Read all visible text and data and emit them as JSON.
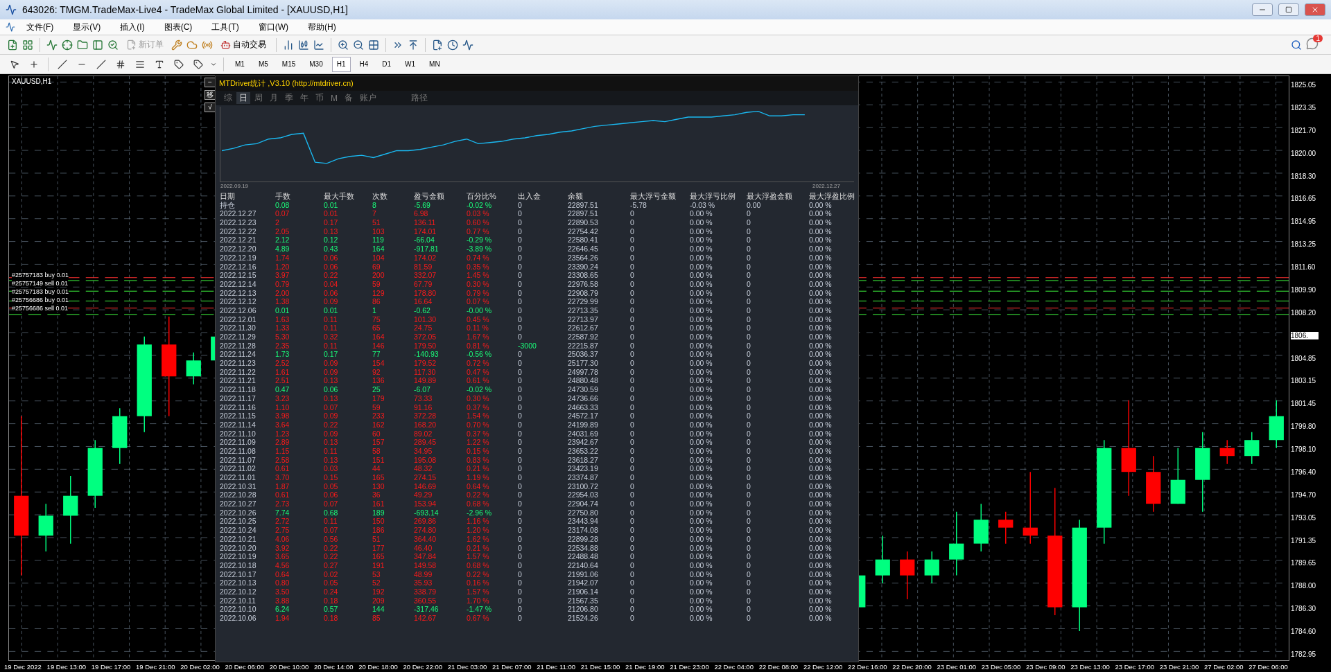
{
  "window": {
    "title": "643026: TMGM.TradeMax-Live4 - TradeMax Global Limited - [XAUUSD,H1]"
  },
  "menu": [
    "文件(F)",
    "显示(V)",
    "插入(I)",
    "图表(C)",
    "工具(T)",
    "窗口(W)",
    "帮助(H)"
  ],
  "toolbar": {
    "new_order": {
      "label": "新订单",
      "disabled": true
    },
    "auto_trading": {
      "label": "自动交易"
    },
    "notification_count": "1"
  },
  "timeframes": [
    {
      "label": "M1",
      "selected": false
    },
    {
      "label": "M5",
      "selected": false
    },
    {
      "label": "M15",
      "selected": false
    },
    {
      "label": "M30",
      "selected": false
    },
    {
      "label": "H1",
      "selected": true
    },
    {
      "label": "H4",
      "selected": false
    },
    {
      "label": "D1",
      "selected": false
    },
    {
      "label": "W1",
      "selected": false
    },
    {
      "label": "MN",
      "selected": false
    }
  ],
  "chart": {
    "symbol": "XAUUSD,H1",
    "side_buttons": [
      "−",
      "移",
      "√"
    ],
    "orders": [
      "#25757183 buy 0.01",
      "#25757149 sell 0.01",
      "#25757183 buy 0.01",
      "#25756686 buy 0.01",
      "#25756686 sell 0.01"
    ],
    "price_axis": [
      "1825.05",
      "1823.35",
      "1821.70",
      "1820.00",
      "1818.30",
      "1816.65",
      "1814.95",
      "1813.25",
      "1811.60",
      "1809.90",
      "1808.20",
      "1806.",
      "1804.85",
      "1803.15",
      "1801.45",
      "1799.80",
      "1798.10",
      "1796.40",
      "1794.70",
      "1793.05",
      "1791.35",
      "1789.65",
      "1788.00",
      "1786.30",
      "1784.60",
      "1782.95"
    ],
    "time_axis": [
      "19 Dec 2022",
      "19 Dec 13:00",
      "19 Dec 17:00",
      "19 Dec 21:00",
      "20 Dec 02:00",
      "20 Dec 06:00",
      "20 Dec 10:00",
      "20 Dec 14:00",
      "20 Dec 18:00",
      "20 Dec 22:00",
      "21 Dec 03:00",
      "21 Dec 07:00",
      "21 Dec 11:00",
      "21 Dec 15:00",
      "21 Dec 19:00",
      "21 Dec 23:00",
      "22 Dec 04:00",
      "22 Dec 08:00",
      "22 Dec 12:00",
      "22 Dec 16:00",
      "22 Dec 20:00",
      "23 Dec 01:00",
      "23 Dec 05:00",
      "23 Dec 09:00",
      "23 Dec 13:00",
      "23 Dec 17:00",
      "23 Dec 21:00",
      "27 Dec 02:00",
      "27 Dec 06:00"
    ]
  },
  "stats": {
    "title": "MTDriver统计 ,V3.10 (http://mtdriver.cn)",
    "tabs": [
      {
        "label": "综",
        "selected": false
      },
      {
        "label": "日",
        "selected": true
      },
      {
        "label": "周",
        "selected": false
      },
      {
        "label": "月",
        "selected": false
      },
      {
        "label": "季",
        "selected": false
      },
      {
        "label": "年",
        "selected": false
      },
      {
        "label": "币",
        "selected": false
      },
      {
        "label": "M",
        "selected": false
      },
      {
        "label": "备",
        "selected": false
      },
      {
        "label": "账户",
        "selected": false
      },
      {
        "label": "路径",
        "selected": false
      }
    ],
    "curve_start": "2022.09.19",
    "curve_end": "2022.12.27",
    "columns": [
      "日期",
      "手数",
      "最大手数",
      "次数",
      "盈亏金额",
      "百分比%",
      "出入金",
      "余额",
      "最大浮亏金额",
      "最大浮亏比例",
      "最大浮盈金额",
      "最大浮盈比例"
    ],
    "rows": [
      {
        "kind": "loss",
        "cells": [
          "持仓",
          "0.08",
          "0.01",
          "8",
          "-5.69",
          "-0.02 %",
          "0",
          "22897.51",
          "-5.78",
          "-0.03 %",
          "0.00",
          "0.00 %"
        ]
      },
      {
        "kind": "profit",
        "cells": [
          "2022.12.27",
          "0.07",
          "0.01",
          "7",
          "6.98",
          "0.03 %",
          "0",
          "22897.51",
          "0",
          "0.00 %",
          "0",
          "0.00 %"
        ]
      },
      {
        "kind": "profit",
        "cells": [
          "2022.12.23",
          "2",
          "0.17",
          "51",
          "136.11",
          "0.60 %",
          "0",
          "22890.53",
          "0",
          "0.00 %",
          "0",
          "0.00 %"
        ]
      },
      {
        "kind": "profit",
        "cells": [
          "2022.12.22",
          "2.05",
          "0.13",
          "103",
          "174.01",
          "0.77 %",
          "0",
          "22754.42",
          "0",
          "0.00 %",
          "0",
          "0.00 %"
        ]
      },
      {
        "kind": "loss",
        "cells": [
          "2022.12.21",
          "2.12",
          "0.12",
          "119",
          "-66.04",
          "-0.29 %",
          "0",
          "22580.41",
          "0",
          "0.00 %",
          "0",
          "0.00 %"
        ]
      },
      {
        "kind": "loss",
        "cells": [
          "2022.12.20",
          "4.89",
          "0.43",
          "164",
          "-917.81",
          "-3.89 %",
          "0",
          "22646.45",
          "0",
          "0.00 %",
          "0",
          "0.00 %"
        ]
      },
      {
        "kind": "profit",
        "cells": [
          "2022.12.19",
          "1.74",
          "0.06",
          "104",
          "174.02",
          "0.74 %",
          "0",
          "23564.26",
          "0",
          "0.00 %",
          "0",
          "0.00 %"
        ]
      },
      {
        "kind": "profit",
        "cells": [
          "2022.12.16",
          "1.20",
          "0.06",
          "69",
          "81.59",
          "0.35 %",
          "0",
          "23390.24",
          "0",
          "0.00 %",
          "0",
          "0.00 %"
        ]
      },
      {
        "kind": "profit",
        "cells": [
          "2022.12.15",
          "3.97",
          "0.22",
          "200",
          "332.07",
          "1.45 %",
          "0",
          "23308.65",
          "0",
          "0.00 %",
          "0",
          "0.00 %"
        ]
      },
      {
        "kind": "profit",
        "cells": [
          "2022.12.14",
          "0.79",
          "0.04",
          "59",
          "67.79",
          "0.30 %",
          "0",
          "22976.58",
          "0",
          "0.00 %",
          "0",
          "0.00 %"
        ]
      },
      {
        "kind": "profit",
        "cells": [
          "2022.12.13",
          "2.00",
          "0.06",
          "129",
          "178.80",
          "0.79 %",
          "0",
          "22908.79",
          "0",
          "0.00 %",
          "0",
          "0.00 %"
        ]
      },
      {
        "kind": "profit",
        "cells": [
          "2022.12.12",
          "1.38",
          "0.09",
          "86",
          "16.64",
          "0.07 %",
          "0",
          "22729.99",
          "0",
          "0.00 %",
          "0",
          "0.00 %"
        ]
      },
      {
        "kind": "loss",
        "cells": [
          "2022.12.06",
          "0.01",
          "0.01",
          "1",
          "-0.62",
          "-0.00 %",
          "0",
          "22713.35",
          "0",
          "0.00 %",
          "0",
          "0.00 %"
        ]
      },
      {
        "kind": "profit",
        "cells": [
          "2022.12.01",
          "1.63",
          "0.11",
          "75",
          "101.30",
          "0.45 %",
          "0",
          "22713.97",
          "0",
          "0.00 %",
          "0",
          "0.00 %"
        ]
      },
      {
        "kind": "profit",
        "cells": [
          "2022.11.30",
          "1.33",
          "0.11",
          "65",
          "24.75",
          "0.11 %",
          "0",
          "22612.67",
          "0",
          "0.00 %",
          "0",
          "0.00 %"
        ]
      },
      {
        "kind": "profit",
        "cells": [
          "2022.11.29",
          "5.30",
          "0.32",
          "164",
          "372.05",
          "1.67 %",
          "0",
          "22587.92",
          "0",
          "0.00 %",
          "0",
          "0.00 %"
        ]
      },
      {
        "kind": "profit",
        "cells": [
          "2022.11.28",
          "2.35",
          "0.11",
          "146",
          "179.50",
          "0.81 %",
          "-3000",
          "22215.87",
          "0",
          "0.00 %",
          "0",
          "0.00 %"
        ]
      },
      {
        "kind": "loss",
        "cells": [
          "2022.11.24",
          "1.73",
          "0.17",
          "77",
          "-140.93",
          "-0.56 %",
          "0",
          "25036.37",
          "0",
          "0.00 %",
          "0",
          "0.00 %"
        ]
      },
      {
        "kind": "profit",
        "cells": [
          "2022.11.23",
          "2.52",
          "0.09",
          "154",
          "179.52",
          "0.72 %",
          "0",
          "25177.30",
          "0",
          "0.00 %",
          "0",
          "0.00 %"
        ]
      },
      {
        "kind": "profit",
        "cells": [
          "2022.11.22",
          "1.61",
          "0.09",
          "92",
          "117.30",
          "0.47 %",
          "0",
          "24997.78",
          "0",
          "0.00 %",
          "0",
          "0.00 %"
        ]
      },
      {
        "kind": "profit",
        "cells": [
          "2022.11.21",
          "2.51",
          "0.13",
          "136",
          "149.89",
          "0.61 %",
          "0",
          "24880.48",
          "0",
          "0.00 %",
          "0",
          "0.00 %"
        ]
      },
      {
        "kind": "loss",
        "cells": [
          "2022.11.18",
          "0.47",
          "0.06",
          "25",
          "-6.07",
          "-0.02 %",
          "0",
          "24730.59",
          "0",
          "0.00 %",
          "0",
          "0.00 %"
        ]
      },
      {
        "kind": "profit",
        "cells": [
          "2022.11.17",
          "3.23",
          "0.13",
          "179",
          "73.33",
          "0.30 %",
          "0",
          "24736.66",
          "0",
          "0.00 %",
          "0",
          "0.00 %"
        ]
      },
      {
        "kind": "profit",
        "cells": [
          "2022.11.16",
          "1.10",
          "0.07",
          "59",
          "91.16",
          "0.37 %",
          "0",
          "24663.33",
          "0",
          "0.00 %",
          "0",
          "0.00 %"
        ]
      },
      {
        "kind": "profit",
        "cells": [
          "2022.11.15",
          "3.98",
          "0.09",
          "233",
          "372.28",
          "1.54 %",
          "0",
          "24572.17",
          "0",
          "0.00 %",
          "0",
          "0.00 %"
        ]
      },
      {
        "kind": "profit",
        "cells": [
          "2022.11.14",
          "3.64",
          "0.22",
          "162",
          "168.20",
          "0.70 %",
          "0",
          "24199.89",
          "0",
          "0.00 %",
          "0",
          "0.00 %"
        ]
      },
      {
        "kind": "profit",
        "cells": [
          "2022.11.10",
          "1.23",
          "0.09",
          "60",
          "89.02",
          "0.37 %",
          "0",
          "24031.69",
          "0",
          "0.00 %",
          "0",
          "0.00 %"
        ]
      },
      {
        "kind": "profit",
        "cells": [
          "2022.11.09",
          "2.89",
          "0.13",
          "157",
          "289.45",
          "1.22 %",
          "0",
          "23942.67",
          "0",
          "0.00 %",
          "0",
          "0.00 %"
        ]
      },
      {
        "kind": "profit",
        "cells": [
          "2022.11.08",
          "1.15",
          "0.11",
          "58",
          "34.95",
          "0.15 %",
          "0",
          "23653.22",
          "0",
          "0.00 %",
          "0",
          "0.00 %"
        ]
      },
      {
        "kind": "profit",
        "cells": [
          "2022.11.07",
          "2.58",
          "0.13",
          "151",
          "195.08",
          "0.83 %",
          "0",
          "23618.27",
          "0",
          "0.00 %",
          "0",
          "0.00 %"
        ]
      },
      {
        "kind": "profit",
        "cells": [
          "2022.11.02",
          "0.61",
          "0.03",
          "44",
          "48.32",
          "0.21 %",
          "0",
          "23423.19",
          "0",
          "0.00 %",
          "0",
          "0.00 %"
        ]
      },
      {
        "kind": "profit",
        "cells": [
          "2022.11.01",
          "3.70",
          "0.15",
          "165",
          "274.15",
          "1.19 %",
          "0",
          "23374.87",
          "0",
          "0.00 %",
          "0",
          "0.00 %"
        ]
      },
      {
        "kind": "profit",
        "cells": [
          "2022.10.31",
          "1.87",
          "0.05",
          "130",
          "146.69",
          "0.64 %",
          "0",
          "23100.72",
          "0",
          "0.00 %",
          "0",
          "0.00 %"
        ]
      },
      {
        "kind": "profit",
        "cells": [
          "2022.10.28",
          "0.61",
          "0.06",
          "36",
          "49.29",
          "0.22 %",
          "0",
          "22954.03",
          "0",
          "0.00 %",
          "0",
          "0.00 %"
        ]
      },
      {
        "kind": "profit",
        "cells": [
          "2022.10.27",
          "2.73",
          "0.07",
          "161",
          "153.94",
          "0.68 %",
          "0",
          "22904.74",
          "0",
          "0.00 %",
          "0",
          "0.00 %"
        ]
      },
      {
        "kind": "loss",
        "cells": [
          "2022.10.26",
          "7.74",
          "0.68",
          "189",
          "-693.14",
          "-2.96 %",
          "0",
          "22750.80",
          "0",
          "0.00 %",
          "0",
          "0.00 %"
        ]
      },
      {
        "kind": "profit",
        "cells": [
          "2022.10.25",
          "2.72",
          "0.11",
          "150",
          "269.86",
          "1.16 %",
          "0",
          "23443.94",
          "0",
          "0.00 %",
          "0",
          "0.00 %"
        ]
      },
      {
        "kind": "profit",
        "cells": [
          "2022.10.24",
          "2.75",
          "0.07",
          "186",
          "274.80",
          "1.20 %",
          "0",
          "23174.08",
          "0",
          "0.00 %",
          "0",
          "0.00 %"
        ]
      },
      {
        "kind": "profit",
        "cells": [
          "2022.10.21",
          "4.06",
          "0.56",
          "51",
          "364.40",
          "1.62 %",
          "0",
          "22899.28",
          "0",
          "0.00 %",
          "0",
          "0.00 %"
        ]
      },
      {
        "kind": "profit",
        "cells": [
          "2022.10.20",
          "3.92",
          "0.22",
          "177",
          "46.40",
          "0.21 %",
          "0",
          "22534.88",
          "0",
          "0.00 %",
          "0",
          "0.00 %"
        ]
      },
      {
        "kind": "profit",
        "cells": [
          "2022.10.19",
          "3.65",
          "0.22",
          "165",
          "347.84",
          "1.57 %",
          "0",
          "22488.48",
          "0",
          "0.00 %",
          "0",
          "0.00 %"
        ]
      },
      {
        "kind": "profit",
        "cells": [
          "2022.10.18",
          "4.56",
          "0.27",
          "191",
          "149.58",
          "0.68 %",
          "0",
          "22140.64",
          "0",
          "0.00 %",
          "0",
          "0.00 %"
        ]
      },
      {
        "kind": "profit",
        "cells": [
          "2022.10.17",
          "0.64",
          "0.02",
          "53",
          "48.99",
          "0.22 %",
          "0",
          "21991.06",
          "0",
          "0.00 %",
          "0",
          "0.00 %"
        ]
      },
      {
        "kind": "profit",
        "cells": [
          "2022.10.13",
          "0.80",
          "0.05",
          "52",
          "35.93",
          "0.16 %",
          "0",
          "21942.07",
          "0",
          "0.00 %",
          "0",
          "0.00 %"
        ]
      },
      {
        "kind": "profit",
        "cells": [
          "2022.10.12",
          "3.50",
          "0.24",
          "192",
          "338.79",
          "1.57 %",
          "0",
          "21906.14",
          "0",
          "0.00 %",
          "0",
          "0.00 %"
        ]
      },
      {
        "kind": "profit",
        "cells": [
          "2022.10.11",
          "3.88",
          "0.18",
          "209",
          "360.55",
          "1.70 %",
          "0",
          "21567.35",
          "0",
          "0.00 %",
          "0",
          "0.00 %"
        ]
      },
      {
        "kind": "loss",
        "cells": [
          "2022.10.10",
          "6.24",
          "0.57",
          "144",
          "-317.46",
          "-1.47 %",
          "0",
          "21206.80",
          "0",
          "0.00 %",
          "0",
          "0.00 %"
        ]
      },
      {
        "kind": "profit",
        "cells": [
          "2022.10.06",
          "1.94",
          "0.18",
          "85",
          "142.67",
          "0.67 %",
          "0",
          "21524.26",
          "0",
          "0.00 %",
          "0",
          "0.00 %"
        ]
      }
    ]
  }
}
